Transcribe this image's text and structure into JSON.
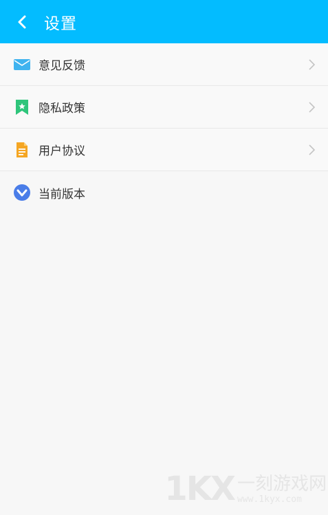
{
  "header": {
    "title": "设置",
    "back_icon": "chevron-left-icon"
  },
  "items": [
    {
      "label": "意见反馈",
      "icon": "mail-icon",
      "icon_color": "#3fb3ef",
      "has_arrow": true
    },
    {
      "label": "隐私政策",
      "icon": "bookmark-star-icon",
      "icon_color": "#2fc57b",
      "has_arrow": true
    },
    {
      "label": "用户协议",
      "icon": "document-icon",
      "icon_color": "#f5a623",
      "has_arrow": true
    },
    {
      "label": "当前版本",
      "icon": "v-badge-icon",
      "icon_color": "#4a7de8",
      "has_arrow": false
    }
  ],
  "colors": {
    "header_bg": "#03bcff",
    "page_bg": "#f7f7f7"
  },
  "watermark": {
    "logo": "1KX",
    "name": "一刻游戏网",
    "url": "www.1kyx.com"
  }
}
